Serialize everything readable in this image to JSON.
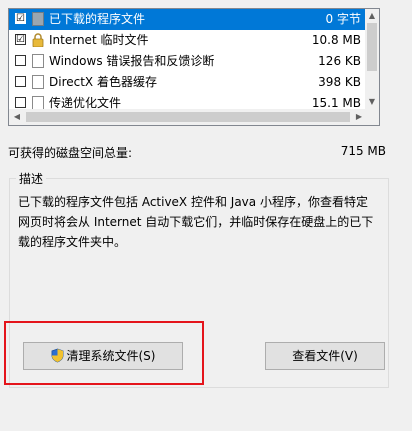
{
  "files": [
    {
      "checked": "☑",
      "name": "已下载的程序文件",
      "size": "0 字节",
      "icon": "document-icon",
      "selected": true
    },
    {
      "checked": "☑",
      "name": "Internet 临时文件",
      "size": "10.8 MB",
      "icon": "lock-icon",
      "selected": false
    },
    {
      "checked": "",
      "name": "Windows 错误报告和反馈诊断",
      "size": "126 KB",
      "icon": "document-icon",
      "selected": false
    },
    {
      "checked": "",
      "name": "DirectX 着色器缓存",
      "size": "398 KB",
      "icon": "document-icon",
      "selected": false
    },
    {
      "checked": "",
      "name": "传递优化文件",
      "size": "15.1 MB",
      "icon": "document-icon",
      "selected": false
    }
  ],
  "scroll": {
    "up": "▲",
    "down": "▼",
    "left": "◀",
    "right": "▶"
  },
  "summary": {
    "label": "可获得的磁盘空间总量:",
    "value": "715 MB"
  },
  "description": {
    "title": "描述",
    "text": "已下载的程序文件包括 ActiveX 控件和 Java 小程序，你查看特定网页时将会从 Internet 自动下载它们，并临时保存在硬盘上的已下载的程序文件夹中。"
  },
  "buttons": {
    "clean": "清理系统文件(S)",
    "view": "查看文件(V)"
  },
  "colors": {
    "selection": "#0078d7",
    "highlight": "#e4141b"
  }
}
